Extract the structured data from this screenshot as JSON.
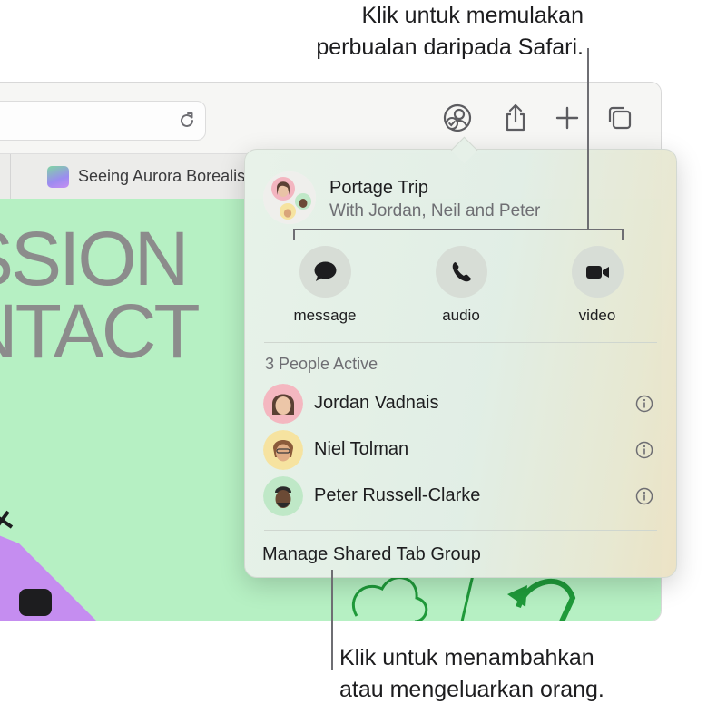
{
  "callouts": {
    "top_line1": "Klik untuk memulakan",
    "top_line2": "perbualan daripada Safari.",
    "bottom_line1": "Klik untuk menambahkan",
    "bottom_line2": "atau mengeluarkan orang."
  },
  "browser": {
    "tab_title": "Seeing Aurora Borealis",
    "hero_line1": "SSION",
    "hero_line2": "NTACT"
  },
  "popover": {
    "group_title": "Portage Trip",
    "group_subtitle": "With Jordan, Neil and Peter",
    "actions": [
      {
        "label": "message",
        "icon": "message-bubble-icon"
      },
      {
        "label": "audio",
        "icon": "phone-icon"
      },
      {
        "label": "video",
        "icon": "video-camera-icon"
      }
    ],
    "people_header": "3 People Active",
    "people": [
      {
        "name": "Jordan Vadnais",
        "avatar_color": "#f4b7c0"
      },
      {
        "name": "Niel Tolman",
        "avatar_color": "#f6e3a0"
      },
      {
        "name": "Peter Russell-Clarke",
        "avatar_color": "#bfe8c7"
      }
    ],
    "manage_label": "Manage Shared Tab Group"
  },
  "colors": {
    "page_background": "#b6f0c3",
    "action_circle": "#d7ddd6"
  }
}
